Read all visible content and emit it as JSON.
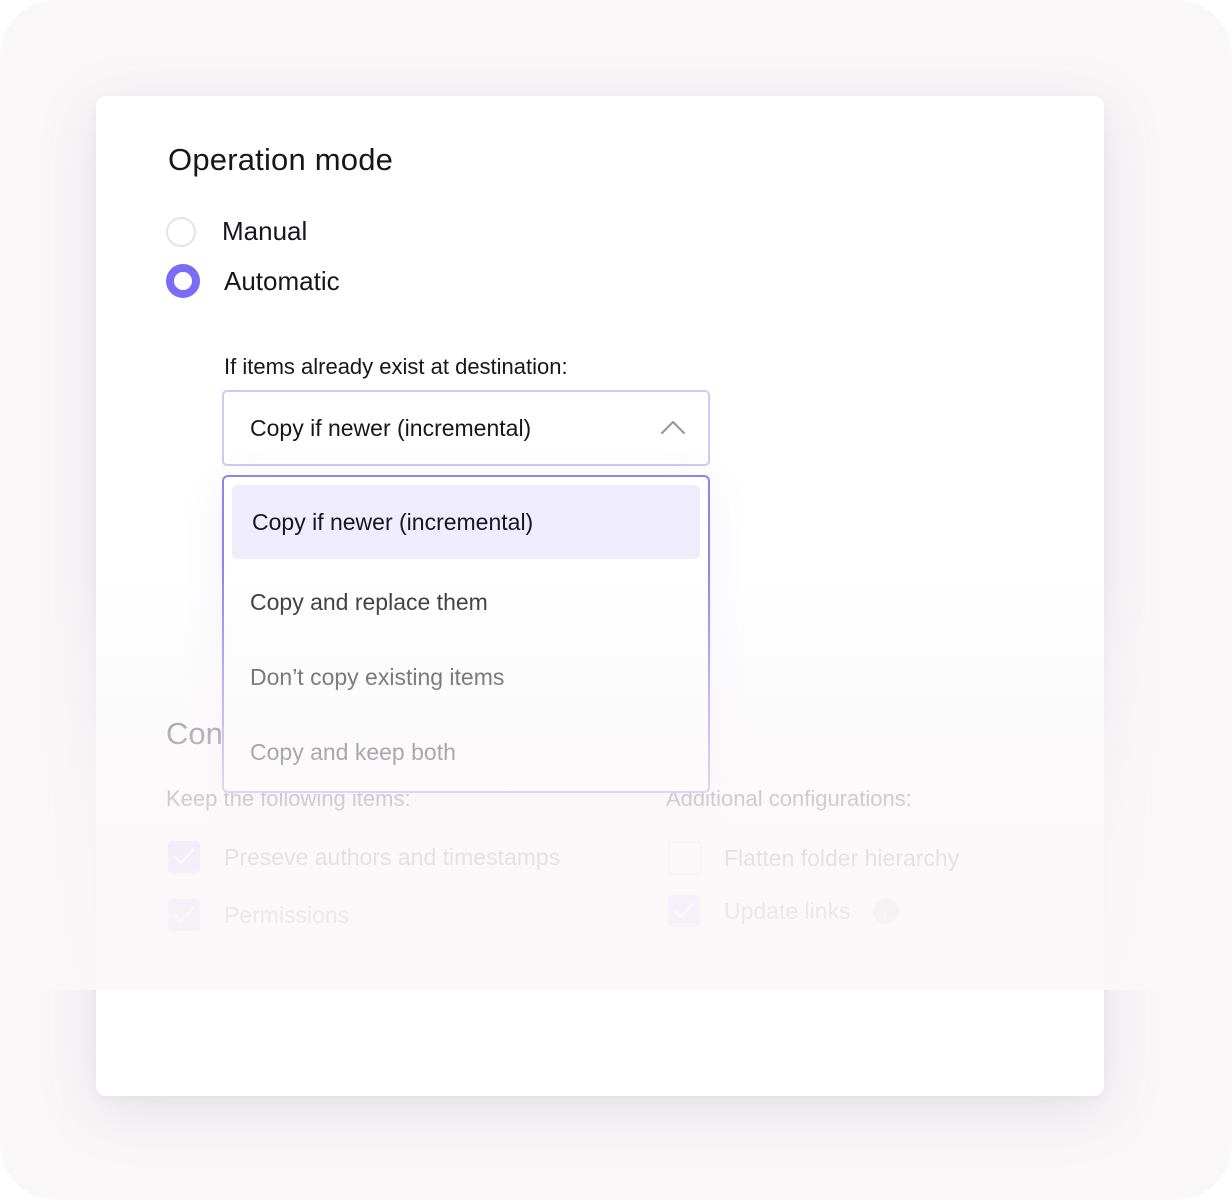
{
  "operation": {
    "title": "Operation mode",
    "options": [
      {
        "label": "Manual",
        "selected": false
      },
      {
        "label": "Automatic",
        "selected": true
      }
    ]
  },
  "conflict": {
    "label": "If items already exist at destination:",
    "selected_value": "Copy if newer (incremental)",
    "options": [
      {
        "label": "Copy if newer (incremental)",
        "selected": true
      },
      {
        "label": "Copy and replace them",
        "selected": false
      },
      {
        "label": "Don’t copy existing items",
        "selected": false
      },
      {
        "label": "Copy and keep both",
        "selected": false
      }
    ]
  },
  "configuration": {
    "title_visible": "Con",
    "keep_label": "Keep the following items:",
    "keep_items": [
      {
        "label": "Preseve authors and timestamps",
        "checked": true
      },
      {
        "label": "Permissions",
        "checked": true
      }
    ],
    "additional_label": "Additional configurations:",
    "additional_items": [
      {
        "label": "Flatten folder hierarchy",
        "checked": false
      },
      {
        "label": "Update links",
        "checked": true,
        "info_icon": "info-icon"
      }
    ]
  },
  "colors": {
    "accent": "#7b6cf6",
    "selected_option_bg": "#efecfc",
    "dropdown_border": "#8f84ee"
  }
}
